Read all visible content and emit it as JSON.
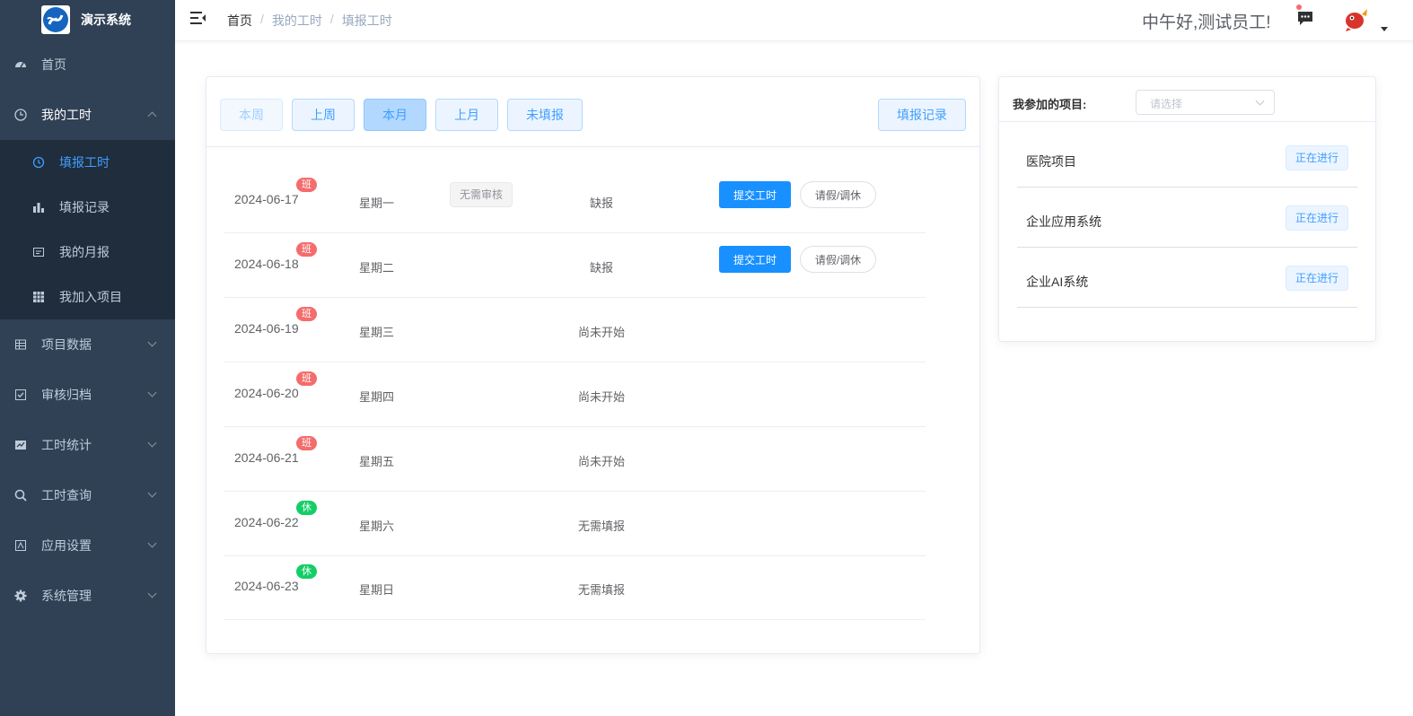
{
  "app": {
    "title": "演示系统"
  },
  "sidebar": {
    "items": [
      {
        "label": "首页",
        "icon": "dashboard-icon"
      },
      {
        "label": "我的工时",
        "icon": "clock-icon",
        "expanded": true,
        "children": [
          {
            "label": "填报工时",
            "icon": "time-fill-icon",
            "active": true
          },
          {
            "label": "填报记录",
            "icon": "bar-chart-icon"
          },
          {
            "label": "我的月报",
            "icon": "report-icon"
          },
          {
            "label": "我加入项目",
            "icon": "table-icon"
          }
        ]
      },
      {
        "label": "项目数据",
        "icon": "grid-icon"
      },
      {
        "label": "审核归档",
        "icon": "checkbox-icon"
      },
      {
        "label": "工时统计",
        "icon": "chart-icon"
      },
      {
        "label": "工时查询",
        "icon": "search-icon"
      },
      {
        "label": "应用设置",
        "icon": "settings-doc-icon"
      },
      {
        "label": "系统管理",
        "icon": "gear-icon"
      }
    ]
  },
  "header": {
    "breadcrumb": [
      "首页",
      "我的工时",
      "填报工时"
    ],
    "greeting": "中午好,测试员工!"
  },
  "toolbar": {
    "this_week": "本周",
    "last_week": "上周",
    "this_month": "本月",
    "last_month": "上月",
    "unfilled": "未填报",
    "records": "填报记录"
  },
  "days": [
    {
      "date": "2024-06-17",
      "badge": "班",
      "badge_type": "work",
      "weekday": "星期一",
      "review": "无需审核",
      "status": "缺报",
      "submit": "提交工时",
      "leave": "请假/调休"
    },
    {
      "date": "2024-06-18",
      "badge": "班",
      "badge_type": "work",
      "weekday": "星期二",
      "status": "缺报",
      "submit": "提交工时",
      "leave": "请假/调休"
    },
    {
      "date": "2024-06-19",
      "badge": "班",
      "badge_type": "work",
      "weekday": "星期三",
      "status": "尚未开始"
    },
    {
      "date": "2024-06-20",
      "badge": "班",
      "badge_type": "work",
      "weekday": "星期四",
      "status": "尚未开始"
    },
    {
      "date": "2024-06-21",
      "badge": "班",
      "badge_type": "work",
      "weekday": "星期五",
      "status": "尚未开始"
    },
    {
      "date": "2024-06-22",
      "badge": "休",
      "badge_type": "rest",
      "weekday": "星期六",
      "status": "无需填报"
    },
    {
      "date": "2024-06-23",
      "badge": "休",
      "badge_type": "rest",
      "weekday": "星期日",
      "status": "无需填报"
    }
  ],
  "projects_panel": {
    "label": "我参加的项目:",
    "select_placeholder": "请选择",
    "projects": [
      {
        "name": "医院项目",
        "status": "正在进行"
      },
      {
        "name": "企业应用系统",
        "status": "正在进行"
      },
      {
        "name": "企业AI系统",
        "status": "正在进行"
      }
    ]
  },
  "colors": {
    "sidebar_bg": "#304156",
    "submenu_bg": "#1f2d3d",
    "active": "#409eff",
    "primary_btn": "#1890ff",
    "work_badge": "#f56c6c",
    "rest_badge": "#13ce66"
  }
}
